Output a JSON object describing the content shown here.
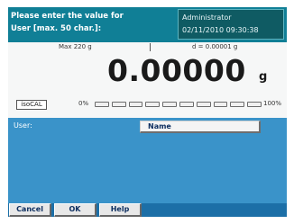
{
  "header": {
    "prompt_line1": "Please enter the value for",
    "prompt_line2": "User [max. 50 char.]:",
    "user": "Administrator",
    "datetime": "02/11/2010 09:30:38"
  },
  "weighing": {
    "max_label": "Max 220 g",
    "d_label": "d = 0.00001 g",
    "value": "0.00000",
    "unit": "g",
    "isocal_label": "isoCAL",
    "scale_min": "0%",
    "scale_max": "100%",
    "capacity_fraction": 0,
    "segments": 10
  },
  "form": {
    "user_label": "User:",
    "name_value": "Name"
  },
  "footer": {
    "cancel_label": "Cancel",
    "ok_label": "OK",
    "help_label": "Help"
  },
  "colors": {
    "header_bg": "#107f96",
    "screen_bg": "#3a93c9",
    "user_box_bg": "#0f5b63"
  }
}
